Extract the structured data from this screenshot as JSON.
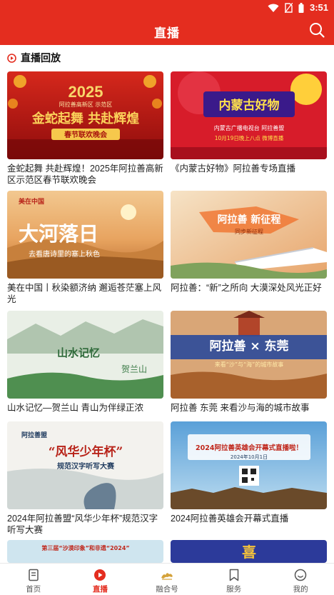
{
  "status_bar": {
    "time": "3:51",
    "icons": [
      "wifi-icon",
      "no-sim-icon",
      "battery-icon"
    ]
  },
  "header": {
    "title": "直播",
    "search_icon": "search-icon"
  },
  "section": {
    "icon": "live-play-icon",
    "title": "直播回放"
  },
  "colors": {
    "brand_red": "#e42d1f",
    "tab_inactive": "#555555"
  },
  "cards": [
    {
      "title": "金蛇起舞  共赴辉煌！2025年阿拉善高新区示范区春节联欢晚会",
      "poster": {
        "year": "2025",
        "org": "阿拉善高新区 示范区",
        "headline": "金蛇起舞 共赴辉煌",
        "sub": "春节联欢晚会"
      }
    },
    {
      "title": "《内蒙古好物》阿拉善专场直播",
      "poster": {
        "headline": "内蒙古好物",
        "sub": "内蒙古广播电视台  阿拉善盟",
        "date": "10月19日晚上八点  微博直播"
      }
    },
    {
      "title": "美在中国丨秋染额济纳  邂逅苍茫塞上风光",
      "poster": {
        "tag": "美在中国",
        "headline": "大河落日",
        "sub": "去看唐诗里的塞上秋色"
      }
    },
    {
      "title": " 阿拉善：“新”之所向  大漠深处风光正好",
      "poster": {
        "headline": "阿拉善 新征程",
        "sub": "同步新征程"
      }
    },
    {
      "title": "山水记忆—贺兰山  青山为伴绿正浓",
      "poster": {
        "headline": "山水记忆",
        "sub": "贺兰山"
      }
    },
    {
      "title": "阿拉善    东莞  来看沙与海的城市故事",
      "poster": {
        "headline": "阿拉善 × 东莞",
        "sub": "来看“沙”与“海”的城市故事"
      }
    },
    {
      "title": "2024年阿拉善盟“风华少年杯”规范汉字听写大赛",
      "poster": {
        "org": "阿拉善盟",
        "headline": "“风华少年杯”",
        "sub": "规范汉字听写大赛"
      }
    },
    {
      "title": "2024阿拉善英雄会开幕式直播",
      "poster": {
        "headline": "2024阿拉善英雄会开幕式直播啦！",
        "date": "2024年10月1日"
      }
    },
    {
      "title": "",
      "poster": {
        "headline": "第三届“沙漠印象”和非遗“2024”"
      }
    },
    {
      "title": "",
      "poster": {
        "headline": "喜"
      }
    }
  ],
  "tabs": [
    {
      "label": "首页",
      "icon": "home-doc-icon",
      "active": false
    },
    {
      "label": "直播",
      "icon": "live-play-icon",
      "active": true
    },
    {
      "label": "融合号",
      "icon": "camel-logo-icon",
      "active": false
    },
    {
      "label": "服务",
      "icon": "bookmark-icon",
      "active": false
    },
    {
      "label": "我的",
      "icon": "smile-user-icon",
      "active": false
    }
  ]
}
